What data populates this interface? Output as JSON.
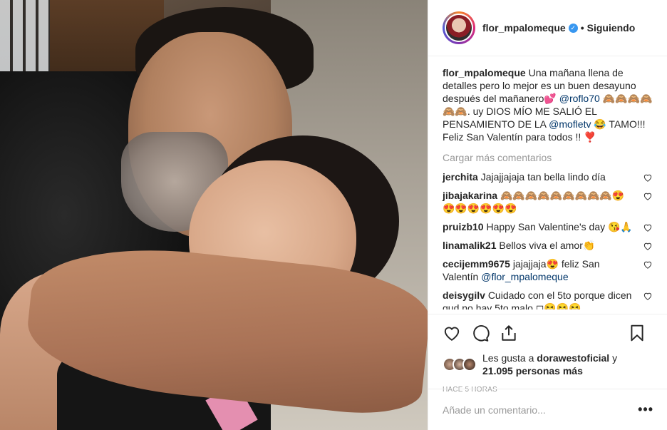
{
  "post": {
    "username": "flor_mpalomeque",
    "follow_status": "Siguiendo",
    "separator": "•",
    "caption": {
      "username": "flor_mpalomeque",
      "part1": "Una mañana llena de detalles pero lo mejor es un buen desayuno después del mañanero💕 ",
      "mention1": "@roflo70",
      "part2": " 🙈🙈🙈🙈🙈🙈. uy DIOS MÍO ME SALIÓ EL PENSAMIENTO DE LA ",
      "mention2": "@mofletv",
      "part3": "😂 TAMO!!! Feliz San Valentín para todos !! ❣️"
    },
    "load_more": "Cargar más comentarios",
    "comments": [
      {
        "user": "jerchita",
        "text": "Jajajjajaja tan bella lindo día",
        "mention": "",
        "text_after": ""
      },
      {
        "user": "jibajakarina",
        "text": "🙈🙈🙈🙈🙈🙈🙈🙈🙈😍😍😍😍😍😍😍",
        "mention": "",
        "text_after": ""
      },
      {
        "user": "pruizb10",
        "text": "Happy San Valentine's day 😘🙏",
        "mention": "",
        "text_after": ""
      },
      {
        "user": "linamalik21",
        "text": "Bellos viva el amor👏",
        "mention": "",
        "text_after": ""
      },
      {
        "user": "cecijemm9675",
        "text": "jajajjaja😍 feliz San Valentín ",
        "mention": "@flor_mpalomeque",
        "text_after": ""
      },
      {
        "user": "deisygilv",
        "text": "Cuidado con el 5to porque dicen qud no hay 5to malo ◻😆😆😆",
        "mention": "",
        "text_after": ""
      }
    ],
    "likes": {
      "prefix": "Les gusta a ",
      "user": "dorawestoficial",
      "middle": " y ",
      "count": "21.095 personas más"
    },
    "time_ago": "Hace 5 horas",
    "add_comment_placeholder": "Añade un comentario...",
    "more_options": "•••"
  },
  "colors": {
    "mention": "#003569",
    "muted": "#999999",
    "verified": "#3897f0",
    "text": "#262626"
  },
  "icons": [
    "heart-icon",
    "comment-icon",
    "share-icon",
    "bookmark-icon",
    "verified-icon",
    "small-heart-icon"
  ]
}
